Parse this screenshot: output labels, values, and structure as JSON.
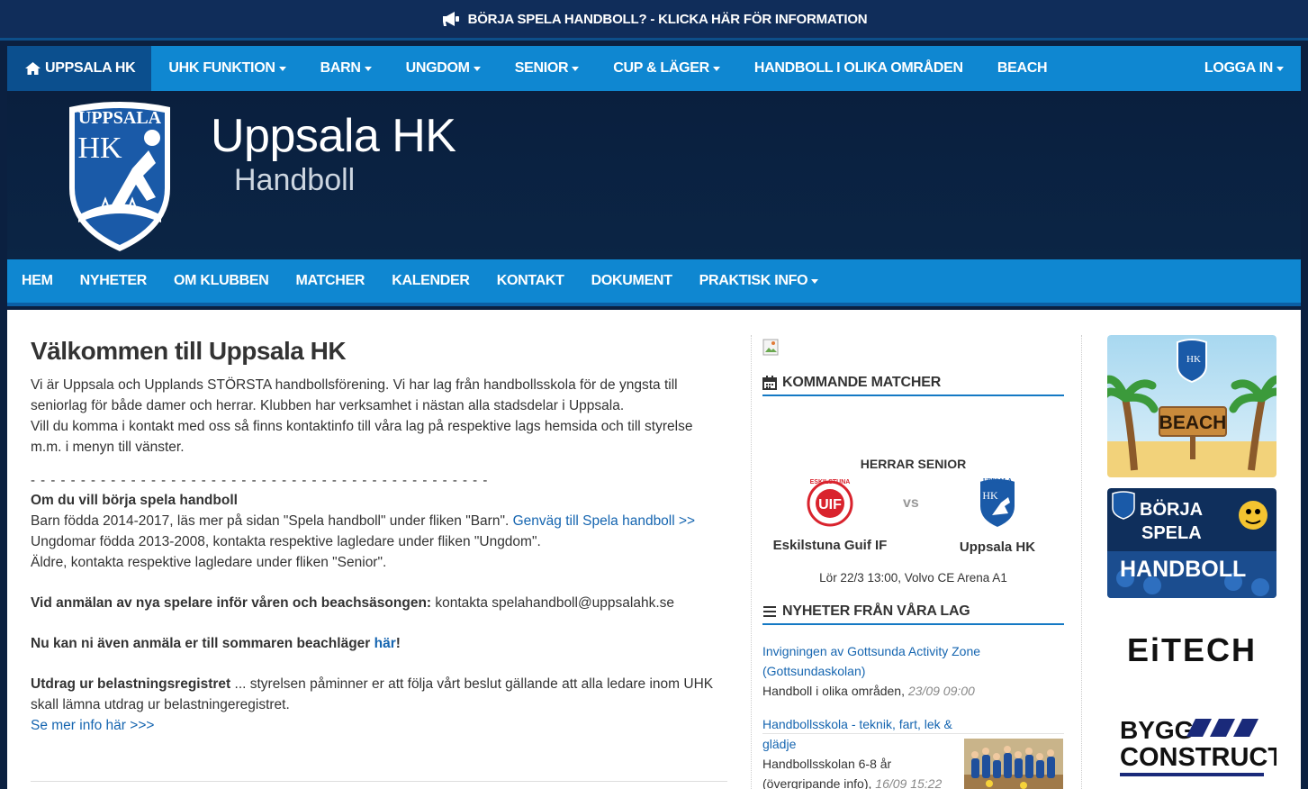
{
  "banner": {
    "text": "BÖRJA SPELA HANDBOLL? - KLICKA HÄR FÖR INFORMATION",
    "icon": "megaphone-icon"
  },
  "main_nav": {
    "home": "UPPSALA HK",
    "items": [
      "UHK FUNKTION",
      "BARN",
      "UNGDOM",
      "SENIOR",
      "CUP & LÄGER",
      "HANDBOLL I OLIKA OMRÅDEN",
      "BEACH"
    ],
    "login": "LOGGA IN"
  },
  "hero": {
    "title": "Uppsala HK",
    "subtitle": "Handboll",
    "logo_text": "UPPSALA",
    "logo_initials": "HK"
  },
  "sub_nav": {
    "items": [
      "HEM",
      "NYHETER",
      "OM KLUBBEN",
      "MATCHER",
      "KALENDER",
      "KONTAKT",
      "DOKUMENT",
      "PRAKTISK INFO"
    ]
  },
  "main": {
    "heading": "Välkommen till Uppsala HK",
    "intro_1": "Vi är Uppsala och Upplands STÖRSTA handbollsförening. Vi har lag från handbollsskola för de yngsta till seniorlag för både damer och herrar. Klubben har verksamhet i nästan alla stadsdelar i Uppsala.",
    "intro_2": "Vill du komma i kontakt med oss så finns kontaktinfo till våra lag på respektive lags hemsida och till styrelse m.m. i menyn till vänster.",
    "dashes": "- - - - - - - - - - - - - - - - - - - - - - - - - - - - - - - - - - - - - - - - - - - - - -",
    "start_heading": "Om du vill börja spela handboll",
    "start_kids": "Barn födda 2014-2017, läs mer på sidan \"Spela handboll\" under fliken \"Barn\".",
    "start_kids_link": "Genväg till Spela handboll >>",
    "start_youth": "Ungdomar födda 2013-2008, kontakta respektive lagledare under fliken \"Ungdom\".",
    "start_older": "Äldre, kontakta respektive lagledare under fliken \"Senior\".",
    "signup_bold": "Vid anmälan av nya spelare inför våren och beachsäsongen:",
    "signup_text": " kontakta spelahandboll@uppsalahk.se",
    "beach_bold": "Nu kan ni även anmäla er till sommaren beachläger ",
    "beach_link": "här",
    "beach_end": "!",
    "record_bold": "Utdrag ur belastningsregistret",
    "record_text": " ... styrelsen påminner er att följa vårt beslut gällande att alla ledare inom UHK skall lämna utdrag ur belastningeregistret.",
    "record_link": "Se mer info här >>>"
  },
  "matches": {
    "heading": "KOMMANDE MATCHER",
    "category": "HERRAR SENIOR",
    "home_team": "Eskilstuna Guif IF",
    "home_logo_text": "ESKILSTUNA",
    "away_team": "Uppsala HK",
    "away_logo_text": "UPPSALA",
    "vs": "vs",
    "info": "Lör 22/3 13:00, Volvo CE Arena A1"
  },
  "news": {
    "heading": "NYHETER FRÅN VÅRA LAG",
    "items": [
      {
        "title": "Invigningen av Gottsunda Activity Zone (Gottsundaskolan)",
        "team": "Handboll i olika områden, ",
        "time": "23/09 09:00"
      },
      {
        "title": "Handbollsskola - teknik, fart, lek & glädje",
        "team": "Handbollsskolan 6-8 år (övergripande info), ",
        "time": "16/09 15:22"
      }
    ]
  },
  "ads": {
    "beach": "BEACH",
    "borja_1": "BÖRJA",
    "borja_2": "SPELA",
    "borja_3": "HANDBOLL",
    "sponsor_1": "EiTECH",
    "sponsor_2a": "BYGG",
    "sponsor_2b": "CONSTRUCT"
  },
  "colors": {
    "nav_blue": "#0f87d1",
    "dark_navy": "#0b2040",
    "link": "#1565b0"
  }
}
